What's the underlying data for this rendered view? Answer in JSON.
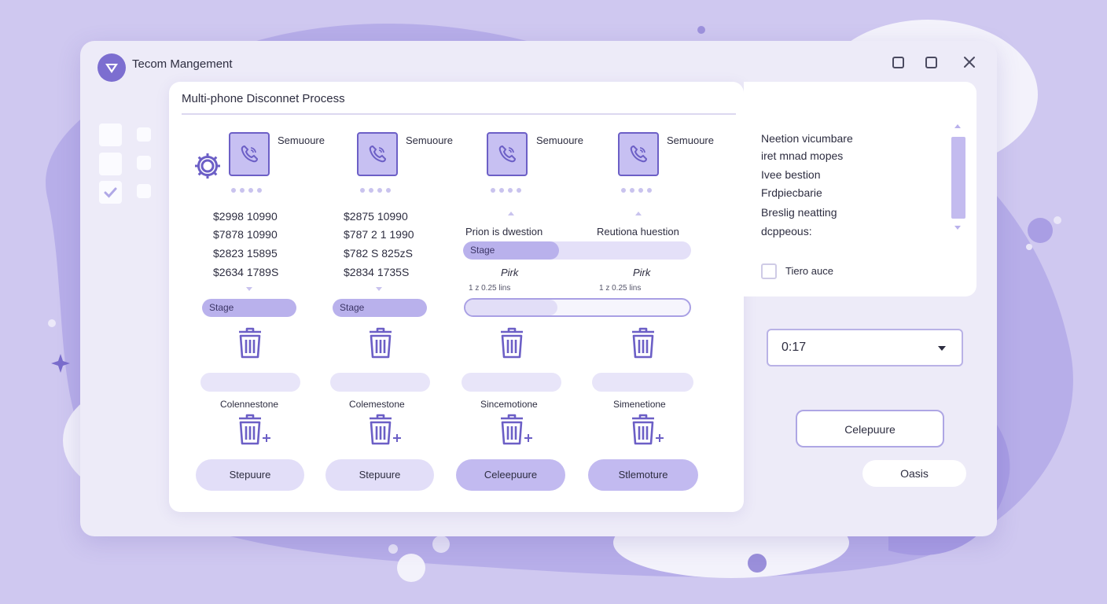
{
  "window": {
    "title": "Tecom Mangement",
    "controls": [
      "minimize",
      "maximize",
      "close"
    ]
  },
  "dialog": {
    "title": "Multi-phone Disconnet Process",
    "columns": [
      {
        "label": "Semuoure",
        "amounts": [
          "$2998 10990",
          "$7878 10990",
          "$2823 15895",
          "$2634 1789S"
        ],
        "stage": "Stage",
        "caption": "Colennestone",
        "button": "Stepuure"
      },
      {
        "label": "Semuoure",
        "amounts": [
          "$2875 10990",
          "$787 2 1 1990",
          "$782 S 825zS",
          "$2834 1735S"
        ],
        "stage": "Stage",
        "caption": "Colemestone",
        "button": "Stepuure"
      },
      {
        "label": "Semuoure",
        "heading": "Prion is dwestion",
        "stage": "Stage",
        "stage_fill": 0.42,
        "sub_label": "Pirk",
        "small": "1 z 0.25 lins",
        "caption": "Sincemotione",
        "button": "Celeepuure"
      },
      {
        "label": "Semuoure",
        "heading": "Reutiona huestion",
        "sub_label": "Pirk",
        "small": "1 z 0.25 lins",
        "caption": "Simenetione",
        "button": "Stlemoture"
      }
    ],
    "outlined_progress": 0.41
  },
  "right_panel": {
    "lines": [
      "Neetion vicumbare",
      "iret mnad mopes",
      "Ivee bestion",
      "Frdpiecbarie",
      "Breslig neatting",
      "dcppeous:"
    ],
    "checkbox_label": "Tiero auce",
    "checkbox_checked": false
  },
  "select": {
    "value": "0:17"
  },
  "buttons": {
    "primary": "Celepuure",
    "secondary": "Oasis"
  },
  "colors": {
    "accent": "#7c6ed0",
    "tile": "#c7c0f2",
    "background": "#cfc8f0"
  }
}
